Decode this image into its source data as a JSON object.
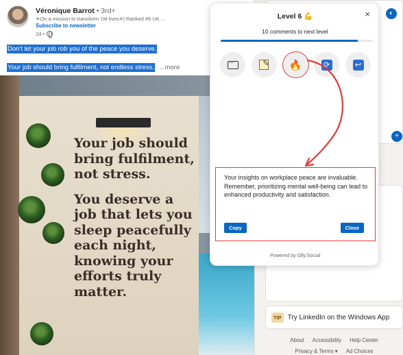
{
  "post": {
    "author_name": "Véronique Barrot",
    "degree": "• 3rd+",
    "tagline": "✳On a mission to transform 1M lives✳| Ranked #5 UK ...",
    "subscribe": "Subscribe to newsletter",
    "posted": "2d •",
    "line1": "Don't let your job rob you of the peace you deserve.",
    "line2": "Your job should bring fulfilment, not endless stress.",
    "more": "...more",
    "image_quote": {
      "paragraph1": "Your job should bring fulfilment, not stress.",
      "paragraph2": "You deserve a job that lets you sleep peacefully each night, knowing your efforts truly matter."
    }
  },
  "popup": {
    "close_icon": "×",
    "level_title": "Level 6 💪",
    "level_subtitle": "10 comments to next level",
    "progress_fraction": 0.9,
    "actions": [
      {
        "name": "comment",
        "icon": "comment-icon"
      },
      {
        "name": "notes",
        "icon": "notepad-icon"
      },
      {
        "name": "fire",
        "icon": "fire-icon",
        "glyph": "🔥",
        "selected": true
      },
      {
        "name": "repost",
        "icon": "repeat-icon",
        "glyph": "⟳"
      },
      {
        "name": "reply",
        "icon": "return-icon",
        "glyph": "↩"
      }
    ],
    "generated_comment": "Your insights on workplace peace are invaluable. Remember, prioritizing mental well-being can lead to enhanced productivity and satisfaction.",
    "copy_label": "Copy",
    "close_label": "Close",
    "powered_by": "Powered by Olly.Social",
    "accent": "#0a66c2",
    "highlight": "#e23b3b"
  },
  "sidebar": {
    "tip_badge": "TIP",
    "tip_text": "Try LinkedIn on the Windows App",
    "footer_links_row1": [
      "About",
      "Accessibility",
      "Help Center"
    ],
    "footer_links_row2": [
      "Privacy & Terms ▾",
      "Ad Choices"
    ]
  }
}
